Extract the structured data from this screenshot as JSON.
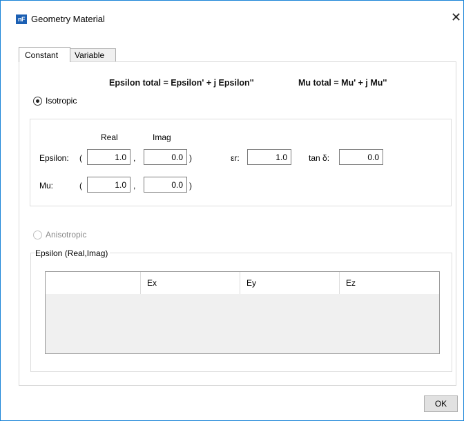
{
  "window": {
    "title": "Geometry Material",
    "app_icon_text": "nF"
  },
  "tabs": [
    {
      "label": "Constant",
      "selected": true
    },
    {
      "label": "Variable",
      "selected": false
    }
  ],
  "formula": {
    "epsilon": "Epsilon total = Epsilon' + j Epsilon''",
    "mu": "Mu total = Mu' + j Mu''"
  },
  "isotropic": {
    "label": "Isotropic",
    "selected": true,
    "headers": {
      "real": "Real",
      "imag": "Imag"
    },
    "epsilon": {
      "label": "Epsilon:",
      "open_paren": "(",
      "comma": ",",
      "close_paren": ")",
      "real": "1.0",
      "imag": "0.0",
      "er_label": "εr:",
      "er_value": "1.0",
      "tan_label": "tan δ:",
      "tan_value": "0.0"
    },
    "mu": {
      "label": "Mu:",
      "open_paren": "(",
      "comma": ",",
      "close_paren": ")",
      "real": "1.0",
      "imag": "0.0"
    }
  },
  "anisotropic": {
    "label": "Anisotropic",
    "selected": false,
    "enabled": false,
    "group_label": "Epsilon (Real,Imag)",
    "columns": [
      "",
      "Ex",
      "Ey",
      "Ez"
    ]
  },
  "buttons": {
    "ok": "OK"
  }
}
